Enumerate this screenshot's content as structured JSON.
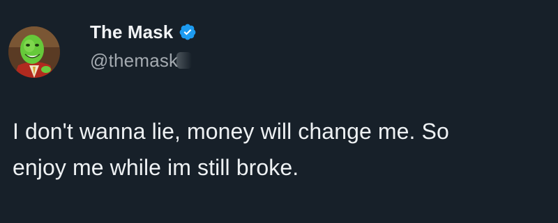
{
  "author": {
    "display_name": "The Mask",
    "handle": "@themask",
    "verified": true,
    "badge_color": "#1d9bf0"
  },
  "tweet": {
    "lines": [
      "I don't wanna lie, money will change me. So",
      "enjoy me while im still broke."
    ]
  },
  "colors": {
    "background": "#172029",
    "text": "#eef1f3",
    "handle": "#a4aab0"
  },
  "icons": {
    "avatar": "mask-character-avatar",
    "badge": "verified-badge-icon"
  }
}
